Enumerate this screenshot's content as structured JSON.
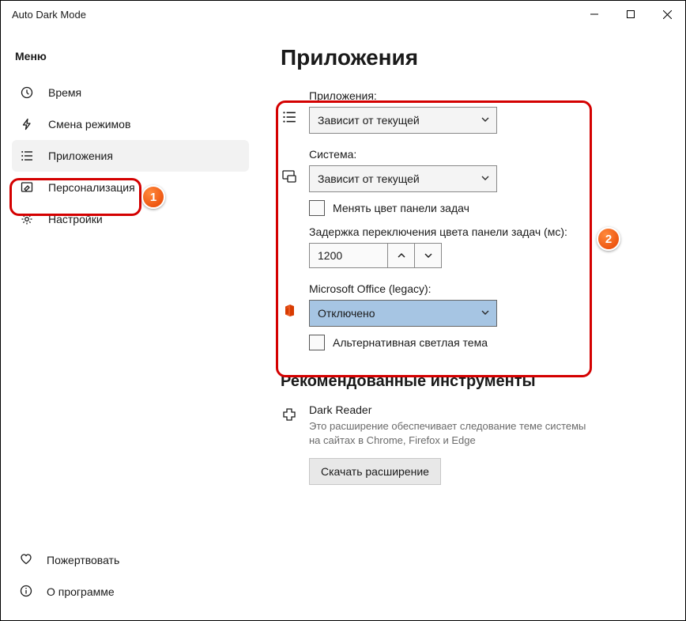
{
  "window": {
    "title": "Auto Dark Mode"
  },
  "sidebar": {
    "menu_label": "Меню",
    "items": [
      {
        "label": "Время"
      },
      {
        "label": "Смена режимов"
      },
      {
        "label": "Приложения",
        "active": true
      },
      {
        "label": "Персонализация"
      },
      {
        "label": "Настройки"
      }
    ],
    "bottom": [
      {
        "label": "Пожертвовать"
      },
      {
        "label": "О программе"
      }
    ]
  },
  "content": {
    "title": "Приложения",
    "apps": {
      "label": "Приложения:",
      "selected": "Зависит от текущей"
    },
    "system": {
      "label": "Система:",
      "selected": "Зависит от текущей",
      "checkbox_label": "Менять цвет панели задач",
      "delay_label": "Задержка переключения цвета панели задач (мс):",
      "delay_value": "1200"
    },
    "office": {
      "label": "Microsoft Office (legacy):",
      "selected": "Отключено",
      "checkbox_label": "Альтернативная светлая тема"
    },
    "tools": {
      "heading": "Рекомендованные инструменты",
      "name": "Dark Reader",
      "desc": "Это расширение обеспечивает следование теме системы на сайтах в Chrome, Firefox и Edge",
      "button": "Скачать расширение"
    }
  },
  "annotations": {
    "badge1": "1",
    "badge2": "2"
  }
}
